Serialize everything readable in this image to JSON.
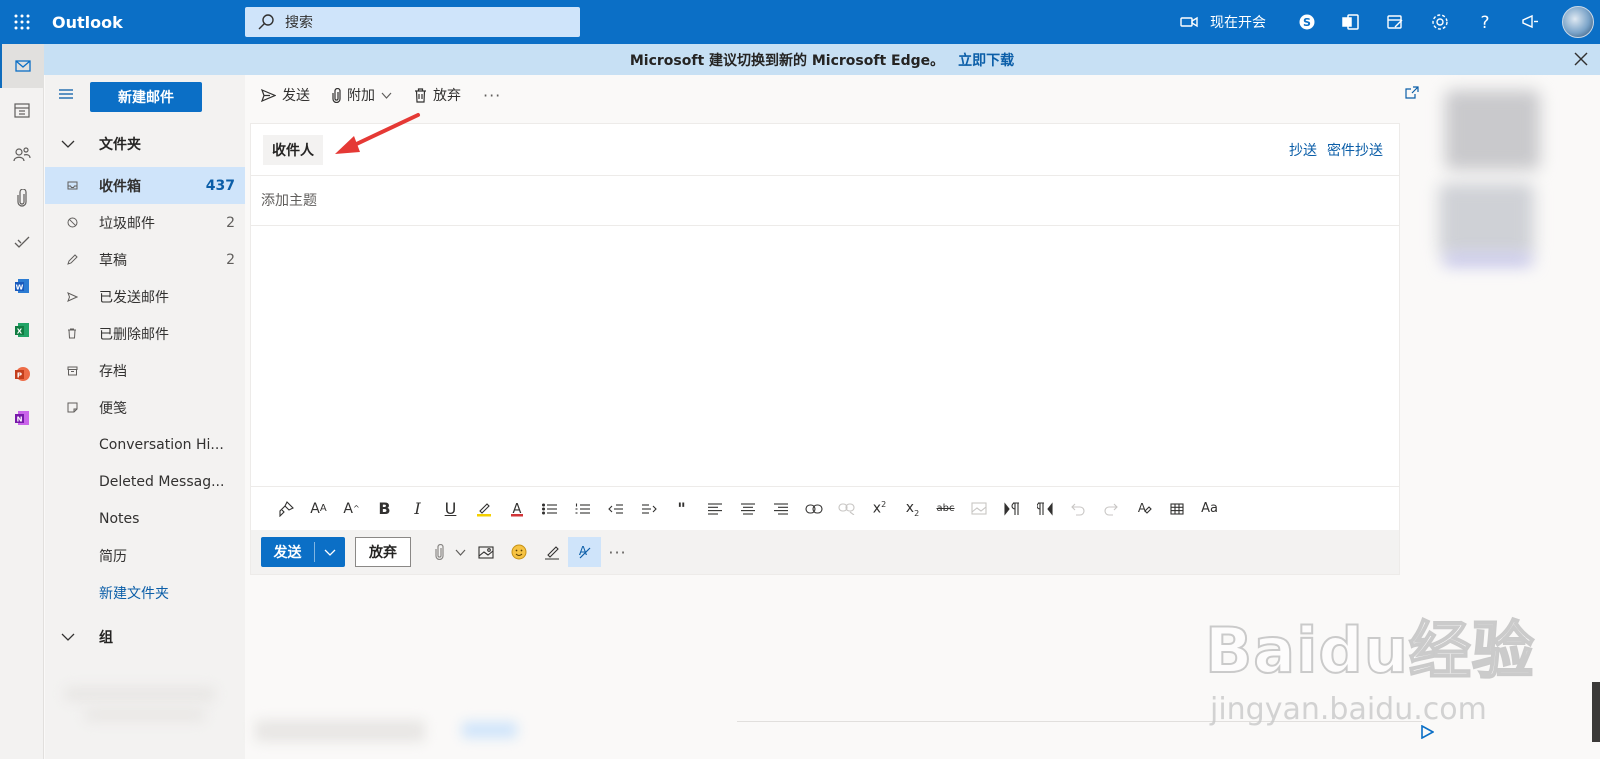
{
  "app": {
    "name": "Outlook"
  },
  "search": {
    "placeholder": "搜索"
  },
  "topbar": {
    "meet_now": "现在开会"
  },
  "banner": {
    "text": "Microsoft 建议切换到新的 Microsoft Edge。",
    "link": "立即下载"
  },
  "sidebar": {
    "new_mail": "新建邮件",
    "folders_header": "文件夹",
    "folders": [
      {
        "name": "收件箱",
        "count": "437",
        "icon": "inbox-icon"
      },
      {
        "name": "垃圾邮件",
        "count": "2",
        "icon": "junk-icon"
      },
      {
        "name": "草稿",
        "count": "2",
        "icon": "drafts-icon"
      },
      {
        "name": "已发送邮件",
        "count": "",
        "icon": "sent-icon"
      },
      {
        "name": "已删除邮件",
        "count": "",
        "icon": "trash-icon"
      },
      {
        "name": "存档",
        "count": "",
        "icon": "archive-icon"
      },
      {
        "name": "便笺",
        "count": "",
        "icon": "notes-icon"
      },
      {
        "name": "Conversation Hi...",
        "count": ""
      },
      {
        "name": "Deleted Messag...",
        "count": ""
      },
      {
        "name": "Notes",
        "count": ""
      },
      {
        "name": "简历",
        "count": ""
      }
    ],
    "new_folder": "新建文件夹",
    "groups_header": "组"
  },
  "commandbar": {
    "send": "发送",
    "attach": "附加",
    "discard": "放弃"
  },
  "compose": {
    "to_label": "收件人",
    "cc": "抄送",
    "bcc": "密件抄送",
    "subject_placeholder": "添加主题",
    "send_button": "发送",
    "discard_button": "放弃"
  },
  "format_bar": {
    "buttons": [
      "format-painter-icon",
      "font-size-decrease-icon",
      "font-size-increase-icon",
      "bold-icon",
      "italic-icon",
      "underline-icon",
      "highlight-icon",
      "font-color-icon",
      "bullets-icon",
      "numbering-icon",
      "decrease-indent-icon",
      "increase-indent-icon",
      "quote-icon",
      "align-left-icon",
      "align-center-icon",
      "align-right-icon",
      "link-icon",
      "unlink-icon",
      "superscript-icon",
      "subscript-icon",
      "strikethrough-icon",
      "picture-icon",
      "ltr-icon",
      "rtl-icon",
      "undo-icon",
      "redo-icon",
      "clear-format-icon",
      "table-icon",
      "change-case-icon"
    ]
  },
  "watermark": {
    "main": "Baidu经验",
    "sub": "jingyan.baidu.com"
  }
}
